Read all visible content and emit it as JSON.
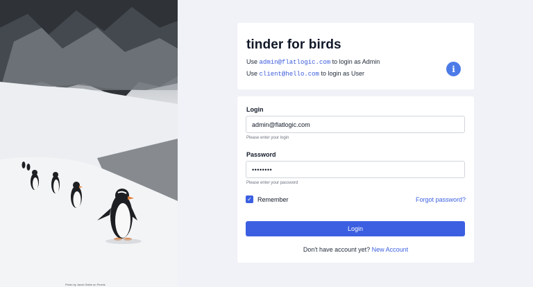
{
  "photo": {
    "credit": "Photo by Jacob Sabin on Pexels"
  },
  "header": {
    "title": "tinder for birds",
    "hint_admin_prefix": "Use",
    "hint_admin_email": "admin@flatlogic.com",
    "hint_admin_suffix": "to login as Admin",
    "hint_user_prefix": "Use",
    "hint_user_email": "client@hello.com",
    "hint_user_suffix": "to login as User",
    "info_icon": "info-icon"
  },
  "form": {
    "login_label": "Login",
    "login_value": "admin@flatlogic.com",
    "login_helper": "Please enter your login",
    "password_label": "Password",
    "password_value": "password",
    "password_helper": "Please enter your password",
    "remember_label": "Remember",
    "remember_checked": true,
    "forgot_label": "Forgot password?",
    "submit_label": "Login",
    "signup_prompt": "Don't have account yet?",
    "signup_link": "New Account"
  },
  "colors": {
    "accent": "#3b5fe0",
    "info": "#4c7be8",
    "background": "#f0f2f7"
  }
}
